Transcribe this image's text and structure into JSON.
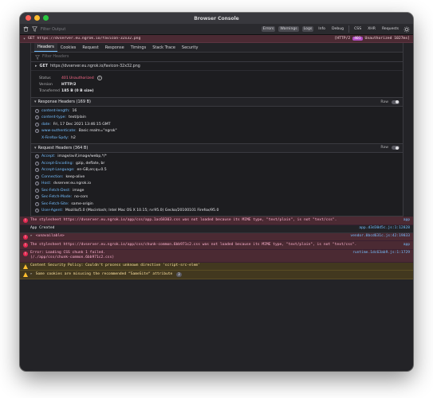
{
  "window": {
    "title": "Browser Console"
  },
  "toolbar": {
    "filter_placeholder": "Filter Output",
    "buttons": [
      "Errors",
      "Warnings",
      "Logs",
      "Info",
      "Debug",
      "CSS",
      "XHR",
      "Requests"
    ]
  },
  "net_request": {
    "method": "GET",
    "url": "https://dvserver.eu.ngrok.io/favicon-32x32.png",
    "protocol": "[HTTP/2",
    "status_code": "401",
    "status_text": "Unauthorized 1027ms]"
  },
  "details": {
    "tabs": [
      "Headers",
      "Cookies",
      "Request",
      "Response",
      "Timings",
      "Stack Trace",
      "Security"
    ],
    "filter_placeholder": "Filter Headers",
    "request_line": {
      "method": "GET",
      "url": "https://dvserver.eu.ngrok.io/favicon-32x32.png"
    },
    "summary": {
      "status_label": "Status",
      "status_code": "401",
      "status_text": "Unauthorized",
      "version_label": "Version",
      "version_value": "HTTP/2",
      "transferred_label": "Transferred",
      "transferred_value": "185 B (0 B size)"
    },
    "response_headers": {
      "title": "Response Headers (169 B)",
      "raw_label": "Raw",
      "items": [
        {
          "key": "content-length:",
          "value": "16"
        },
        {
          "key": "content-type:",
          "value": "text/plain"
        },
        {
          "key": "date:",
          "value": "Fri, 17 Dec 2021 13:46:15 GMT"
        },
        {
          "key": "www-authenticate:",
          "value": "Basic realm=\"ngrok\""
        },
        {
          "key": "X-Firefox-Spdy:",
          "value": "h2"
        }
      ]
    },
    "request_headers": {
      "title": "Request Headers (364 B)",
      "raw_label": "Raw",
      "items": [
        {
          "key": "Accept:",
          "value": "image/avif,image/webp,*/*"
        },
        {
          "key": "Accept-Encoding:",
          "value": "gzip, deflate, br"
        },
        {
          "key": "Accept-Language:",
          "value": "en-GB,en;q=0.5"
        },
        {
          "key": "Connection:",
          "value": "keep-alive"
        },
        {
          "key": "Host:",
          "value": "dvserver.eu.ngrok.io"
        },
        {
          "key": "Sec-Fetch-Dest:",
          "value": "image"
        },
        {
          "key": "Sec-Fetch-Mode:",
          "value": "no-cors"
        },
        {
          "key": "Sec-Fetch-Site:",
          "value": "same-origin"
        },
        {
          "key": "User-Agent:",
          "value": "Mozilla/5.0 (Macintosh; Intel Mac OS X 10.15; rv:95.0) Gecko/20100101 Firefox/95.0"
        }
      ]
    }
  },
  "messages": [
    {
      "level": "error",
      "text": "The stylesheet https://dvserver.eu.ngrok.io/app/css/app.1ac68303.css was not loaded because its MIME type, \"text/plain\", is not \"text/css\".",
      "source": "app"
    },
    {
      "level": "plain",
      "text": "App Created",
      "source": "app.d3d30d5c.js:1:12828"
    },
    {
      "level": "error",
      "text": "<unavailable>",
      "source": "vendor.0bcd631c.js:42:19833"
    },
    {
      "level": "error",
      "text": "The stylesheet https://dvserver.eu.ngrok.io/app/css/chunk-common.6bb971c2.css was not loaded because its MIME type, \"text/plain\", is not \"text/css\".",
      "source": "app"
    },
    {
      "level": "error",
      "text": "Error: Loading CSS chunk 1 failed.\n(/./app/css/chunk-common.6bb971c2.css)",
      "source": "runtime.1dc63ab9.js:1:1729"
    },
    {
      "level": "warning",
      "text": "Content Security Policy: Couldn't process unknown directive 'script-src-elem'",
      "source": ""
    },
    {
      "level": "warning",
      "text": "Some cookies are misusing the recommended “SameSite“ attribute",
      "source": "",
      "count": "3"
    }
  ],
  "colors": {
    "close": "#ff5f57",
    "minimize": "#febc2e",
    "maximize": "#28c840",
    "error_bg": "#4b2a33",
    "warning_bg": "#42381f",
    "accent": "#75bfff"
  }
}
